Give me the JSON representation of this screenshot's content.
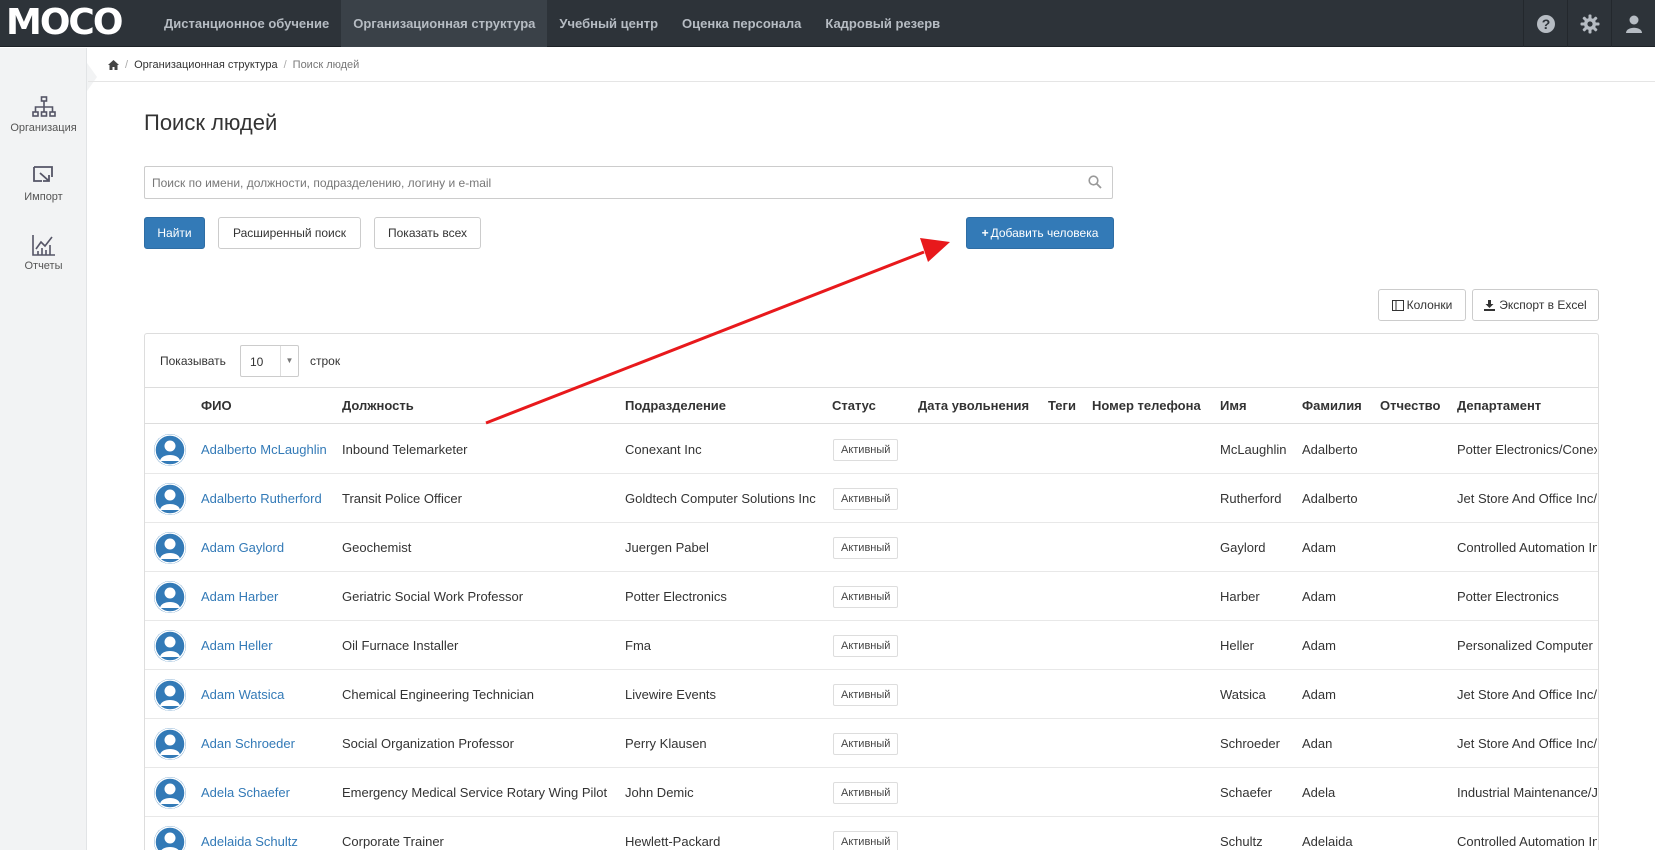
{
  "app": {
    "logo": "MOCO"
  },
  "nav": [
    {
      "label": "Дистанционное обучение",
      "active": false
    },
    {
      "label": "Организационная структура",
      "active": true
    },
    {
      "label": "Учебный центр",
      "active": false
    },
    {
      "label": "Оценка персонала",
      "active": false
    },
    {
      "label": "Кадровый резерв",
      "active": false
    }
  ],
  "top_icons": [
    "help-icon",
    "gear-icon",
    "user-icon"
  ],
  "sidebar": [
    {
      "label": "Организация",
      "icon": "org-structure-icon"
    },
    {
      "label": "Импорт",
      "icon": "import-icon"
    },
    {
      "label": "Отчеты",
      "icon": "reports-icon"
    }
  ],
  "breadcrumb": {
    "home_icon": "home-icon",
    "items": [
      "Организационная структура",
      "Поиск людей"
    ]
  },
  "page": {
    "title": "Поиск людей",
    "search_placeholder": "Поиск по имени, должности, подразделению, логину и e-mail",
    "find_label": "Найти",
    "advanced_label": "Расширенный поиск",
    "show_all_label": "Показать всех",
    "add_person_label": "Добавить человека",
    "columns_label": "Колонки",
    "export_label": "Экспорт в Excel"
  },
  "table": {
    "show_label": "Показывать",
    "rows_label": "строк",
    "page_size": "10",
    "headers": [
      "ФИО",
      "Должность",
      "Подразделение",
      "Статус",
      "Дата увольнения",
      "Теги",
      "Номер телефона",
      "Имя",
      "Фамилия",
      "Отчество",
      "Департамент"
    ],
    "rows": [
      {
        "fio": "Adalberto McLaughlin",
        "position": "Inbound Telemarketer",
        "division": "Conexant Inc",
        "status": "Активный",
        "first": "McLaughlin",
        "last": "Adalberto",
        "dept": "Potter Electronics/Conexant Inc"
      },
      {
        "fio": "Adalberto Rutherford",
        "position": "Transit Police Officer",
        "division": "Goldtech Computer Solutions Inc",
        "status": "Активный",
        "first": "Rutherford",
        "last": "Adalberto",
        "dept": "Jet Store And Office Inc/Goldtech"
      },
      {
        "fio": "Adam Gaylord",
        "position": "Geochemist",
        "division": "Juergen Pabel",
        "status": "Активный",
        "first": "Gaylord",
        "last": "Adam",
        "dept": "Controlled Automation Inc"
      },
      {
        "fio": "Adam Harber",
        "position": "Geriatric Social Work Professor",
        "division": "Potter Electronics",
        "status": "Активный",
        "first": "Harber",
        "last": "Adam",
        "dept": "Potter Electronics"
      },
      {
        "fio": "Adam Heller",
        "position": "Oil Furnace Installer",
        "division": "Fma",
        "status": "Активный",
        "first": "Heller",
        "last": "Adam",
        "dept": "Personalized Computer Inc"
      },
      {
        "fio": "Adam Watsica",
        "position": "Chemical Engineering Technician",
        "division": "Livewire Events",
        "status": "Активный",
        "first": "Watsica",
        "last": "Adam",
        "dept": "Jet Store And Office Inc/Livewire"
      },
      {
        "fio": "Adan Schroeder",
        "position": "Social Organization Professor",
        "division": "Perry Klausen",
        "status": "Активный",
        "first": "Schroeder",
        "last": "Adan",
        "dept": "Jet Store And Office Inc/Perry"
      },
      {
        "fio": "Adela Schaefer",
        "position": "Emergency Medical Service Rotary Wing Pilot",
        "division": "John Demic",
        "status": "Активный",
        "first": "Schaefer",
        "last": "Adela",
        "dept": "Industrial Maintenance/John Demic"
      },
      {
        "fio": "Adelaida Schultz",
        "position": "Corporate Trainer",
        "division": "Hewlett-Packard",
        "status": "Активный",
        "first": "Schultz",
        "last": "Adelaida",
        "dept": "Controlled Automation Inc"
      }
    ]
  },
  "colors": {
    "topbar": "#2d3339",
    "primary": "#337ab7",
    "link": "#337ab7",
    "annotation_arrow": "#e8191c"
  }
}
